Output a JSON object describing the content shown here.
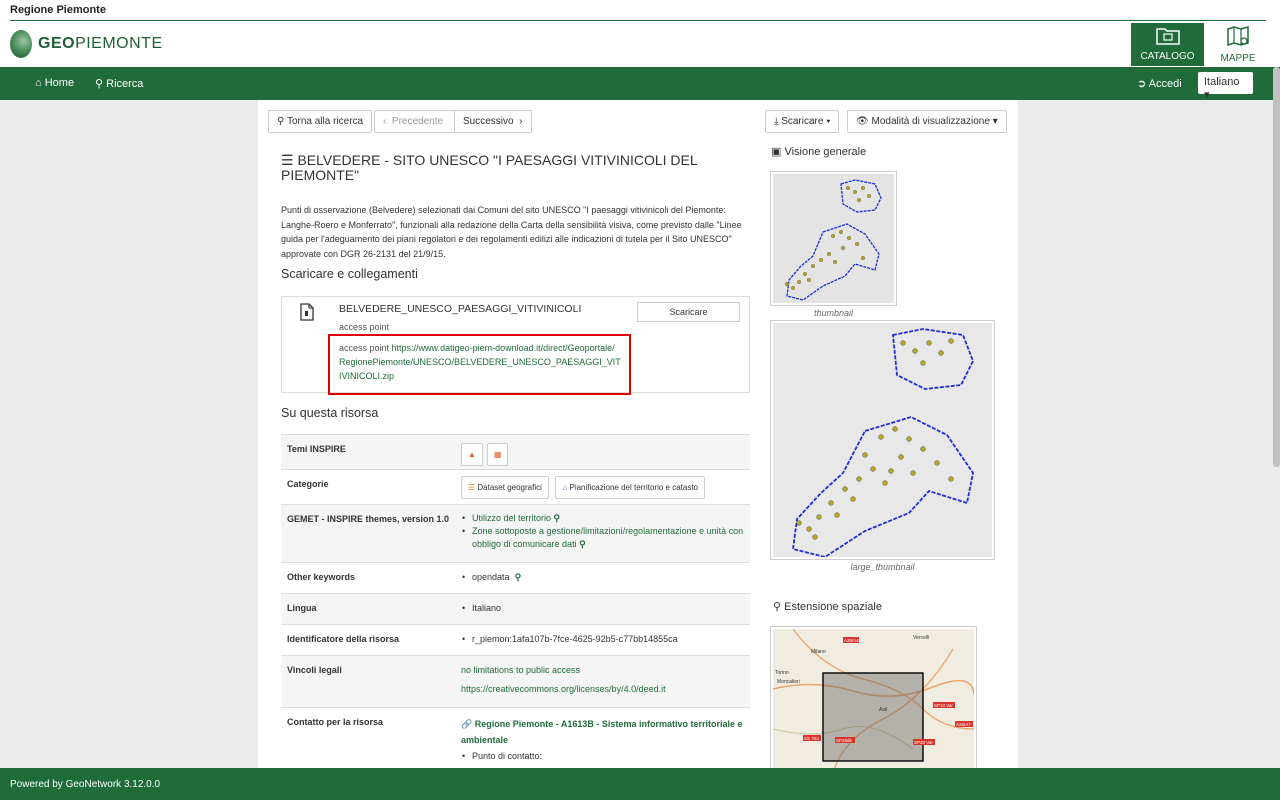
{
  "header": {
    "region_title": "Regione Piemonte",
    "logo_prefix": "GEO",
    "logo_suffix": "PIEMONTE",
    "catalogo_label": "CATALOGO",
    "mappe_label": "MAPPE"
  },
  "nav": {
    "home": "Home",
    "search": "Ricerca",
    "login": "Accedi",
    "language": "Italiano"
  },
  "toolbar": {
    "back": "Torna alla ricerca",
    "prev": "Precedente",
    "next": "Successivo",
    "download": "Scaricare",
    "view_mode": "Modalità di visualizzazione"
  },
  "record": {
    "title": "BELVEDERE - SITO UNESCO \"I PAESAGGI VITIVINICOLI DEL PIEMONTE\"",
    "description": "Punti di osservazione (Belvedere) selezionati dai Comuni del sito UNESCO \"I paesaggi vitivinicoli del Piemonte: Langhe-Roero e Monferrato\", funzionali alla redazione della Carta della sensibilità visiva, come previsto dalle \"Linee guida per l'adeguamento dei piani regolatori e dei regolamenti edilizi alle indicazioni di tutela per il Sito UNESCO\" approvate con DGR 26-2131 del 21/9/15."
  },
  "downloads": {
    "section_title": "Scaricare e collegamenti",
    "name": "BELVEDERE_UNESCO_PAESAGGI_VITIVINICOLI",
    "type": "access point",
    "link_prefix": "access point",
    "link_url": "https://www.datigeo-piem-download.it/direct/Geoportale/RegionePiemonte/UNESCO/BELVEDERE_UNESCO_PAESAGGI_VITIVINICOLI.zip",
    "button": "Scaricare"
  },
  "about": {
    "section_title": "Su questa risorsa",
    "inspire_label": "Temi INSPIRE",
    "categories_label": "Categorie",
    "categories": [
      "Dataset geografici",
      "Pianificazione del territorio e catasto"
    ],
    "gemet_label": "GEMET - INSPIRE themes, version 1.0",
    "gemet": [
      "Utilizzo del territorio",
      "Zone sottoposte a gestione/limitazioni/regolamentazione e unità con obbligo di comunicare dati"
    ],
    "keywords_label": "Other keywords",
    "keywords": "opendata",
    "language_label": "Lingua",
    "language": "Italiano",
    "identifier_label": "Identificatore della risorsa",
    "identifier": "r_piemon:1afa107b-7fce-4625-92b5-c77bb14855ca",
    "legal_label": "Vincoli legali",
    "legal_1": "no limitations to public access",
    "legal_2": "https://creativecommons.org/licenses/by/4.0/deed.it",
    "contact_label": "Contatto per la risorsa",
    "contact_org": "Regione Piemonte - A1613B - Sistema informativo territoriale e ambientale",
    "contact_point": "Punto di contatto:"
  },
  "sidebar": {
    "overview": "Visione generale",
    "thumb_caption": "thumbnail",
    "large_caption": "large_thumbnail",
    "extent": "Estensione spaziale"
  },
  "map_labels": {
    "a": "A26/A4",
    "b": "Vercelli",
    "c": "Milano",
    "d": "Torino",
    "e": "Moncalieri",
    "f": "Asti",
    "g": "SP10 Var",
    "h": "A26/A7",
    "i": "SS 703",
    "j": "SP28dir",
    "k": "SP30 Var"
  },
  "footer": {
    "text": "Powered by GeoNetwork 3.12.0.0"
  },
  "colors": {
    "brand_green": "#1f6b3a",
    "highlight_red": "#e00000",
    "map_outline": "#1a2fd6"
  }
}
